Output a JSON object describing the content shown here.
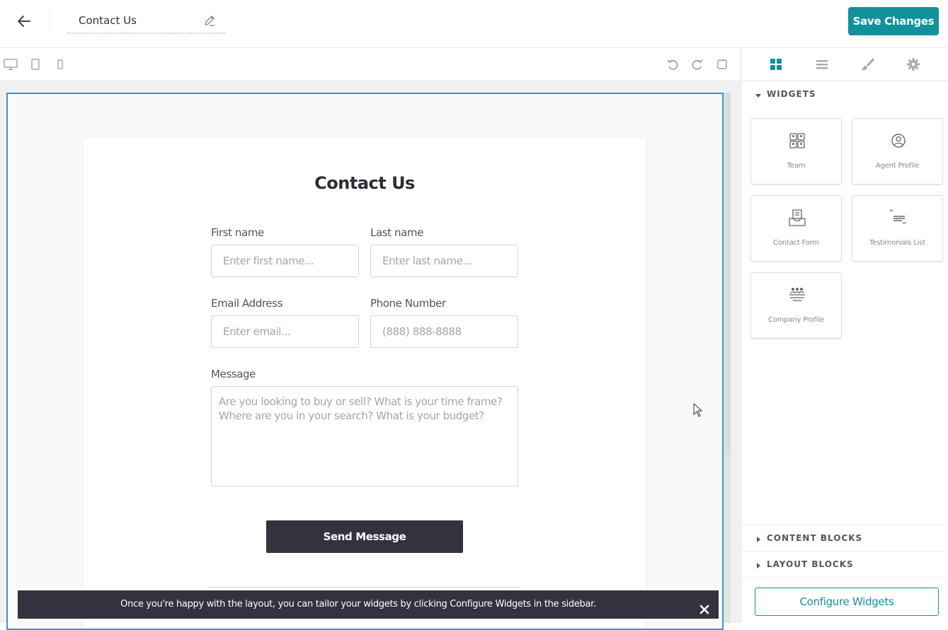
{
  "header": {
    "page_title": "Contact Us",
    "save_label": "Save Changes",
    "accent_color": "#12909c"
  },
  "toolbar": {
    "device_icons": [
      "desktop-icon",
      "tablet-icon",
      "mobile-icon"
    ],
    "action_icons": [
      "undo-icon",
      "redo-icon",
      "preview-icon"
    ]
  },
  "form": {
    "title": "Contact Us",
    "first_name_label": "First name",
    "first_name_placeholder": "Enter first name...",
    "last_name_label": "Last name",
    "last_name_placeholder": "Enter last name...",
    "email_label": "Email Address",
    "email_placeholder": "Enter email...",
    "phone_label": "Phone Number",
    "phone_placeholder": "(888) 888-8888",
    "message_label": "Message",
    "message_placeholder": "Are you looking to buy or sell? What is your time frame? Where are you in your search? What is your budget?",
    "submit_label": "Send Message",
    "selection_color": "#3d94d6"
  },
  "toast": {
    "text": "Once you're happy with the layout, you can tailor your widgets by clicking Configure Widgets in the sidebar."
  },
  "sidebar": {
    "tabs": [
      "widgets-grid-icon",
      "sections-list-icon",
      "brush-icon",
      "settings-gear-icon"
    ],
    "widgets_heading": "WIDGETS",
    "widgets": [
      {
        "label": "Team",
        "icon": "team-icon"
      },
      {
        "label": "Agent Profile",
        "icon": "agent-profile-icon"
      },
      {
        "label": "Contact Form",
        "icon": "contact-form-icon"
      },
      {
        "label": "Testimonials List",
        "icon": "testimonials-icon"
      },
      {
        "label": "Company Profile",
        "icon": "company-profile-icon"
      }
    ],
    "content_blocks_heading": "CONTENT BLOCKS",
    "layout_blocks_heading": "LAYOUT BLOCKS",
    "configure_label": "Configure Widgets"
  }
}
